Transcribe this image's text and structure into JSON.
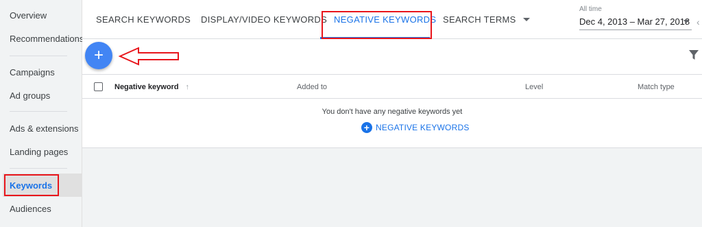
{
  "sidebar": {
    "items": [
      {
        "label": "Overview"
      },
      {
        "label": "Recommendations"
      },
      {
        "label": "Campaigns"
      },
      {
        "label": "Ad groups"
      },
      {
        "label": "Ads & extensions"
      },
      {
        "label": "Landing pages"
      },
      {
        "label": "Keywords"
      },
      {
        "label": "Audiences"
      }
    ],
    "active": "Keywords"
  },
  "tabs": [
    {
      "label": "SEARCH KEYWORDS"
    },
    {
      "label": "DISPLAY/VIDEO KEYWORDS"
    },
    {
      "label": "NEGATIVE KEYWORDS"
    },
    {
      "label": "SEARCH TERMS"
    }
  ],
  "active_tab": "NEGATIVE KEYWORDS",
  "date": {
    "label": "All time",
    "range": "Dec 4, 2013 – Mar 27, 2018"
  },
  "toolbar": {
    "add_symbol": "+"
  },
  "table": {
    "columns": [
      "Negative keyword",
      "Added to",
      "Level",
      "Match type"
    ],
    "sort_symbol": "↑",
    "empty_message": "You don't have any negative keywords yet",
    "empty_action": "NEGATIVE KEYWORDS",
    "empty_action_symbol": "+"
  },
  "colors": {
    "accent": "#1a73e8",
    "fab": "#4285f4",
    "highlight": "#e8151b"
  }
}
